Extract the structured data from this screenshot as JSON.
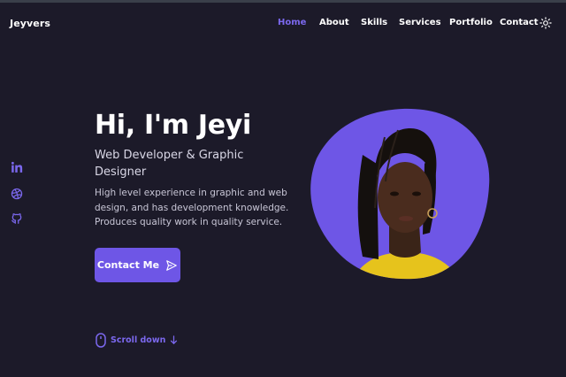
{
  "header": {
    "logo": "Jeyvers",
    "nav": [
      {
        "label": "Home",
        "active": true
      },
      {
        "label": "About",
        "active": false
      },
      {
        "label": "Skills",
        "active": false
      },
      {
        "label": "Services",
        "active": false
      },
      {
        "label": "Portfolio",
        "active": false
      },
      {
        "label": "Contact",
        "active": false
      }
    ],
    "theme_icon": "sun-icon"
  },
  "socials": [
    {
      "icon": "linkedin-icon"
    },
    {
      "icon": "dribbble-icon"
    },
    {
      "icon": "github-icon"
    }
  ],
  "hero": {
    "title": "Hi, I'm Jeyi",
    "subtitle": "Web Developer & Graphic Designer",
    "description": "High level experience in graphic and web design, and has development knowledge. Produces quality work in quality service.",
    "cta_label": "Contact Me",
    "cta_icon": "send-icon",
    "scroll_label": "Scroll down",
    "scroll_icons": [
      "mouse-icon",
      "arrow-down-icon"
    ]
  },
  "colors": {
    "background": "#1c1a29",
    "accent": "#6e56e6",
    "accent_text": "#7b68ee",
    "text": "#ffffff",
    "muted_text": "#c8c6d6"
  }
}
